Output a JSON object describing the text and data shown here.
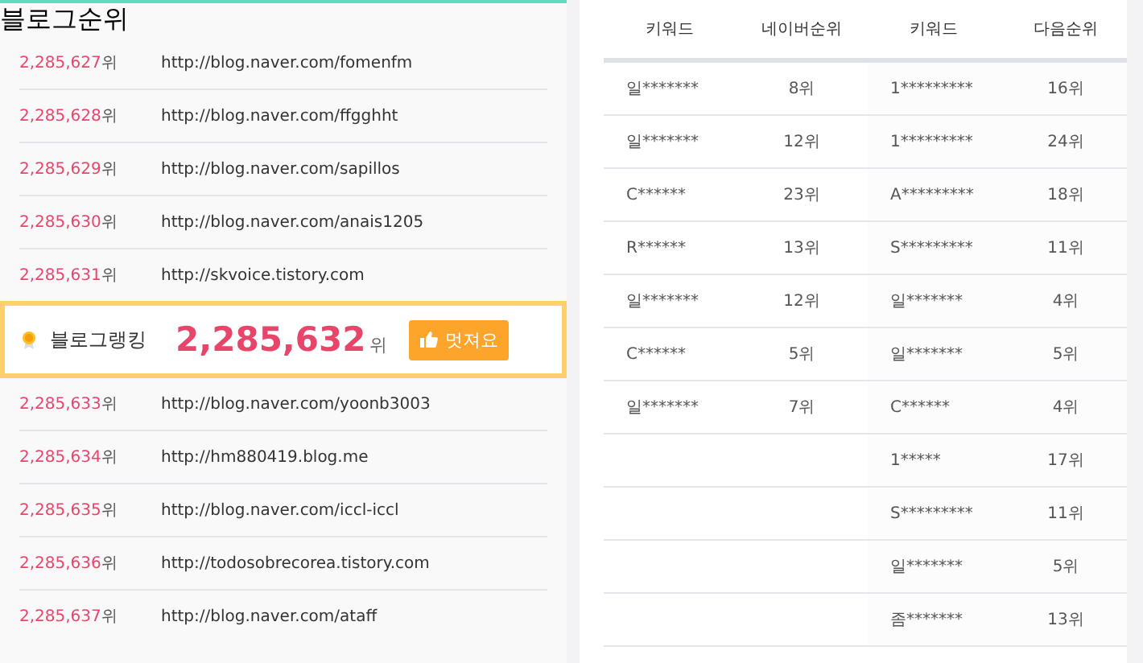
{
  "blog_rank": {
    "title": "블로그순위",
    "rows_before": [
      {
        "rank": "2,285,627",
        "unit": "위",
        "url": "http://blog.naver.com/fomenfm"
      },
      {
        "rank": "2,285,628",
        "unit": "위",
        "url": "http://blog.naver.com/ffgghht"
      },
      {
        "rank": "2,285,629",
        "unit": "위",
        "url": "http://blog.naver.com/sapillos"
      },
      {
        "rank": "2,285,630",
        "unit": "위",
        "url": "http://blog.naver.com/anais1205"
      },
      {
        "rank": "2,285,631",
        "unit": "위",
        "url": "http://skvoice.tistory.com"
      }
    ],
    "highlight": {
      "label": "블로그랭킹",
      "rank": "2,285,632",
      "unit": "위",
      "button": "멋져요"
    },
    "rows_after": [
      {
        "rank": "2,285,633",
        "unit": "위",
        "url": "http://blog.naver.com/yoonb3003"
      },
      {
        "rank": "2,285,634",
        "unit": "위",
        "url": "http://hm880419.blog.me"
      },
      {
        "rank": "2,285,635",
        "unit": "위",
        "url": "http://blog.naver.com/iccl-iccl"
      },
      {
        "rank": "2,285,636",
        "unit": "위",
        "url": "http://todosobrecorea.tistory.com"
      },
      {
        "rank": "2,285,637",
        "unit": "위",
        "url": "http://blog.naver.com/ataff"
      }
    ]
  },
  "keyword_table": {
    "columns": [
      "키워드",
      "네이버순위",
      "키워드",
      "다음순위"
    ],
    "rows": [
      [
        "일*******",
        "8위",
        "1*********",
        "16위"
      ],
      [
        "일*******",
        "12위",
        "1*********",
        "24위"
      ],
      [
        "C******",
        "23위",
        "A*********",
        "18위"
      ],
      [
        "R******",
        "13위",
        "S*********",
        "11위"
      ],
      [
        "일*******",
        "12위",
        "일*******",
        "4위"
      ],
      [
        "C******",
        "5위",
        "일*******",
        "5위"
      ],
      [
        "일*******",
        "7위",
        "C******",
        "4위"
      ],
      [
        "",
        "",
        "1*****",
        "17위"
      ],
      [
        "",
        "",
        "S*********",
        "11위"
      ],
      [
        "",
        "",
        "일*******",
        "5위"
      ],
      [
        "",
        "",
        "좀*******",
        "13위"
      ]
    ]
  }
}
